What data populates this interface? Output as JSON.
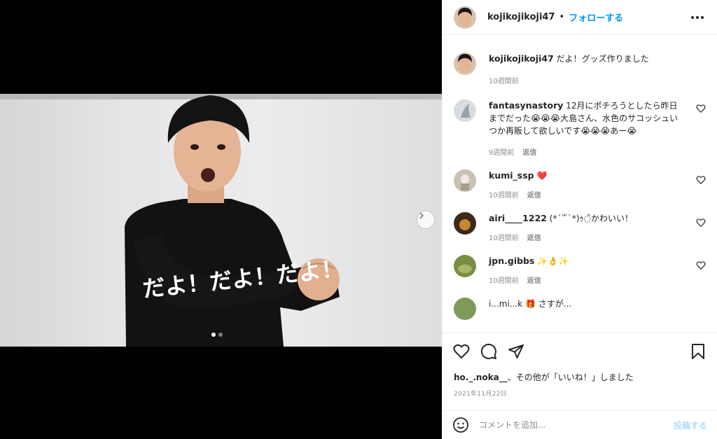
{
  "post": {
    "username": "kojikojikoji47",
    "separator": "•",
    "follow_label": "フォローする",
    "caption": "だよ！グッズ作りました",
    "caption_time": "10週間前",
    "shirt_text": "だよ！だよ！だよ！",
    "likes_user": "ho._.noka__",
    "likes_suffix": "、その他が「いいね！」しました",
    "date": "2021年11月22日",
    "reply_label": "返信"
  },
  "comments": [
    {
      "user": "fantasynastory",
      "text": "12月にポチろうとしたら昨日までだった😭😭😭大島さん、水色のサコッシュいつか再販して欲しいです😭😭😭あー😭",
      "time": "9週間前"
    },
    {
      "user": "kumi_ssp",
      "text": "❤️",
      "time": "10週間前"
    },
    {
      "user": "airi____1222",
      "text": "(*´꒳`*)ｩ◌̑かわいい！",
      "time": "10週間前"
    },
    {
      "user": "jpn.gibbs",
      "text": "✨👌✨",
      "time": "10週間前"
    }
  ],
  "partial_comment": "i...mi...k  🎁 さすが...",
  "add_comment": {
    "placeholder": "コメントを追加...",
    "post_label": "投稿する"
  },
  "colors": {
    "accent": "#0095f6",
    "post_disabled": "#b2dffc",
    "muted": "#8e8e8e"
  },
  "icons": [
    "heart-icon",
    "comment-icon",
    "share-icon",
    "bookmark-icon",
    "emoji-icon",
    "chevron-right-icon",
    "more-icon"
  ]
}
